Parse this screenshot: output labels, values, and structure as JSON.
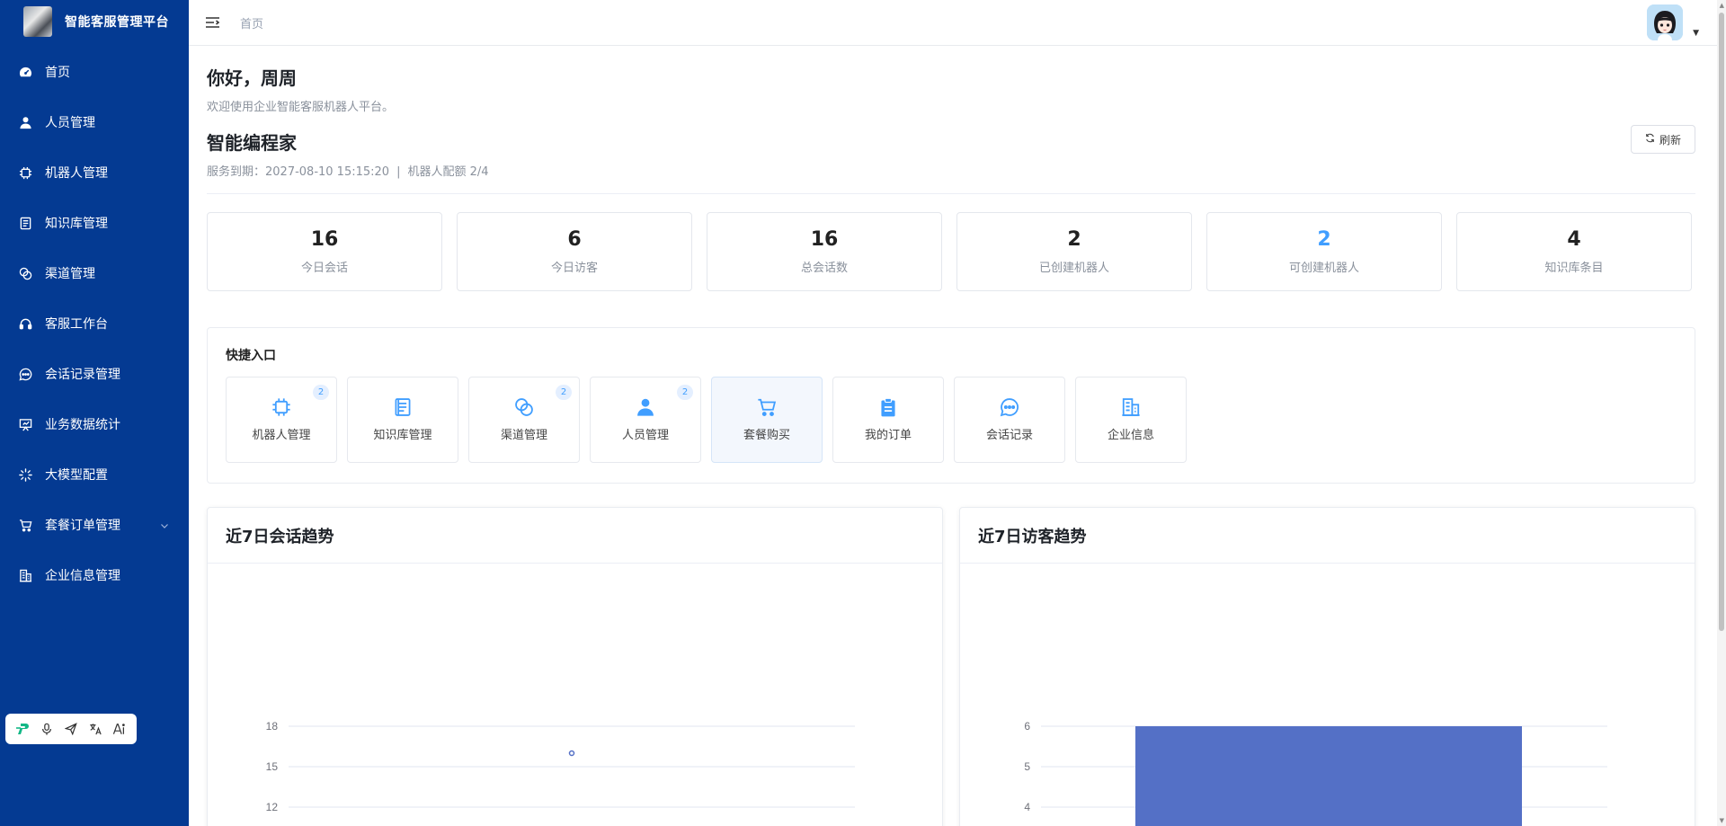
{
  "sidebar": {
    "title": "智能客服管理平台",
    "items": [
      {
        "label": "首页",
        "icon": "dashboard-icon"
      },
      {
        "label": "人员管理",
        "icon": "user-icon"
      },
      {
        "label": "机器人管理",
        "icon": "chip-icon"
      },
      {
        "label": "知识库管理",
        "icon": "document-icon"
      },
      {
        "label": "渠道管理",
        "icon": "link-icon"
      },
      {
        "label": "客服工作台",
        "icon": "headset-icon"
      },
      {
        "label": "会话记录管理",
        "icon": "chat-icon"
      },
      {
        "label": "业务数据统计",
        "icon": "presentation-icon"
      },
      {
        "label": "大模型配置",
        "icon": "loading-icon"
      },
      {
        "label": "套餐订单管理",
        "icon": "cart-icon"
      },
      {
        "label": "企业信息管理",
        "icon": "office-building-icon"
      }
    ]
  },
  "header": {
    "breadcrumb": "首页"
  },
  "main": {
    "greeting": "你好，周周",
    "welcome": "欢迎使用企业智能客服机器人平台。",
    "company_name": "智能编程家",
    "service_expiry": "服务到期：2027-08-10 15:15:20",
    "meta_separator": "|",
    "robot_quota": "机器人配额 2/4",
    "refresh_label": "刷新",
    "stats": [
      {
        "value": "16",
        "label": "今日会话"
      },
      {
        "value": "6",
        "label": "今日访客"
      },
      {
        "value": "16",
        "label": "总会话数"
      },
      {
        "value": "2",
        "label": "已创建机器人"
      },
      {
        "value": "2",
        "label": "可创建机器人"
      },
      {
        "value": "4",
        "label": "知识库条目"
      }
    ],
    "quick": {
      "title": "快捷入口",
      "items": [
        {
          "label": "机器人管理",
          "badge": "2",
          "icon": "chip-icon"
        },
        {
          "label": "知识库管理",
          "badge": "",
          "icon": "document-icon"
        },
        {
          "label": "渠道管理",
          "badge": "2",
          "icon": "link-icon"
        },
        {
          "label": "人员管理",
          "badge": "2",
          "icon": "user-icon"
        },
        {
          "label": "套餐购买",
          "badge": "",
          "icon": "cart-icon"
        },
        {
          "label": "我的订单",
          "badge": "",
          "icon": "clipboard-icon"
        },
        {
          "label": "会话记录",
          "badge": "",
          "icon": "chat-icon"
        },
        {
          "label": "企业信息",
          "badge": "",
          "icon": "office-building-icon"
        }
      ]
    }
  },
  "colors": {
    "sidebar_bg": "#043a92",
    "accent": "#409eff",
    "bar": "#5470c6"
  },
  "chart_data": [
    {
      "type": "line",
      "title": "近7日会话趋势",
      "yticks": [
        "18",
        "15",
        "12"
      ],
      "ylim": [
        12,
        18
      ],
      "points": [
        {
          "y": 16
        }
      ],
      "grid": true
    },
    {
      "type": "bar",
      "title": "近7日访客趋势",
      "yticks": [
        "6",
        "5",
        "4"
      ],
      "ylim": [
        4,
        6
      ],
      "values": [
        6
      ],
      "grid": true
    }
  ]
}
